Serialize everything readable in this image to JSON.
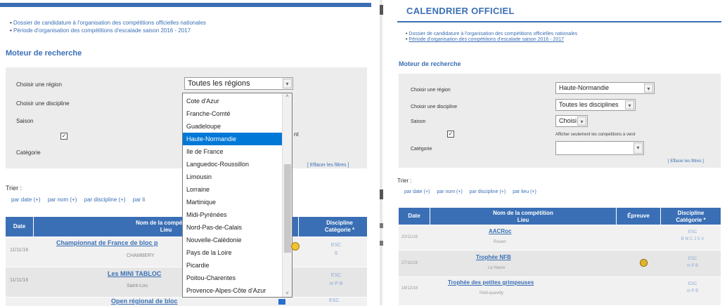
{
  "left": {
    "bullets": [
      "Dossier de candidature à l'organisation des compétitions officielles nationales",
      "Période d'organisation des compétitions d'escalade saison 2016 - 2017"
    ],
    "moteur_title": "Moteur de recherche",
    "labels": {
      "region": "Choisir une région",
      "discipline": "Choisir une discipline",
      "saison": "Saison",
      "categorie": "Catégorie",
      "filter_tail": "nt"
    },
    "region_value": "Toutes les régions",
    "effacer": "[ Effacer les filtres ]",
    "trier": "Trier :",
    "sort_links": [
      "par date (+)",
      "par nom (+)",
      "par discipline (+)",
      "par li"
    ],
    "table_headers": {
      "date": "Date",
      "nom": "Nom de la compétition",
      "lieu": "Lieu",
      "discipline": "Discipline",
      "categorie": "Catégorie *"
    },
    "rows": [
      {
        "date": "11/11/16",
        "name": "Championnat de France de bloc p",
        "lieu": "CHAMBERY",
        "disc": "ESC",
        "cat": "S"
      },
      {
        "date": "11/11/16",
        "name": "Les MINI TABLOC",
        "lieu": "Saint-Lou",
        "disc": "ESC",
        "cat": "m P B"
      },
      {
        "date": "",
        "name": "Open régional de bloc",
        "lieu": "",
        "disc": "ESC",
        "cat": ""
      }
    ],
    "dropdown_options": [
      "Cote d'Azur",
      "Franche-Comté",
      "Guadeloupe",
      "Haute-Normandie",
      "Ile de France",
      "Languedoc-Roussillon",
      "Limousin",
      "Lorraine",
      "Martinique",
      "Midi-Pyrénées",
      "Nord-Pas-de-Calais",
      "Nouvelle-Calédonie",
      "Pays de la Loire",
      "Picardie",
      "Poitou-Charentes",
      "Provence-Alpes-Côte d'Azur"
    ],
    "highlighted_option": "Haute-Normandie"
  },
  "right": {
    "title": "CALENDRIER OFFICIEL",
    "bullets": [
      "Dossier de candidature à l'organisation des compétitions officielles nationales",
      "Période d'organisation des compétitions d'escalade saison 2016 - 2017"
    ],
    "moteur_title": "Moteur de recherche",
    "labels": {
      "region": "Choisir une région",
      "discipline": "Choisir une discipline",
      "saison": "Saison",
      "categorie": "Catégorie",
      "filter_text": "Afficher seulement les compétitions à venir"
    },
    "region_value": "Haute-Normandie",
    "discipline_value": "Toutes les disciplines",
    "saison_value": "Choisi",
    "categorie_value": "",
    "effacer": "[ Effacer les filtres ]",
    "trier": "Trier :",
    "sort_links": [
      "par date (+)",
      "par nom (+)",
      "par discipline (+)",
      "par lieu (+)"
    ],
    "table_headers": {
      "date": "Date",
      "nom": "Nom de la compétition",
      "lieu": "Lieu",
      "epreuve": "Épreuve",
      "discipline": "Discipline",
      "categorie": "Catégorie *"
    },
    "rows": [
      {
        "date": "20/11/16",
        "name": "AACRoc",
        "lieu": "Rouen",
        "disc": "ESC",
        "cat": "B M C J S V"
      },
      {
        "date": "27/11/16",
        "name": "Trophée NFB",
        "lieu": "Le Havre",
        "disc": "ESC",
        "cat": "m P B"
      },
      {
        "date": "18/12/16",
        "name": "Trophée des petites grimpeuses",
        "lieu": "Petit-quevilly",
        "disc": "ESC",
        "cat": "m P B"
      }
    ]
  },
  "colors": {
    "accent": "#3a6fb5",
    "highlight": "#0078d7"
  },
  "icons": {
    "trophy": "trophy-icon",
    "check": "checkbox-checked-icon",
    "dropdown_arrow": "chevron-down-icon"
  }
}
